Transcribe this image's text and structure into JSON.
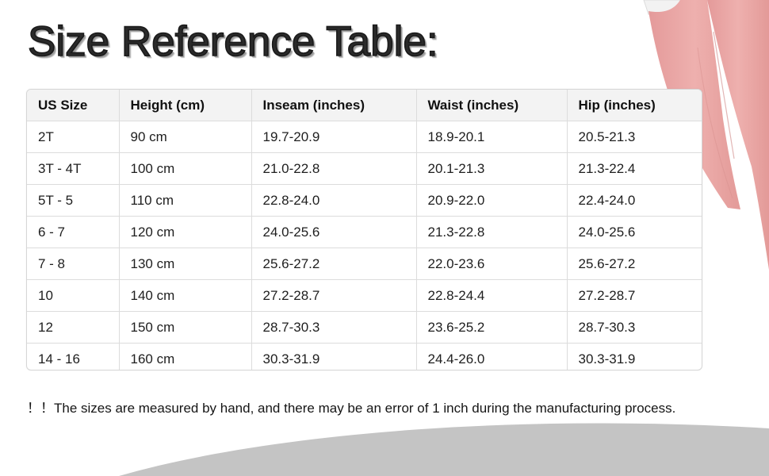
{
  "title": "Size Reference Table:",
  "table": {
    "headers": [
      "US Size",
      "Height (cm)",
      "Inseam (inches)",
      "Waist (inches)",
      "Hip (inches)"
    ],
    "rows": [
      [
        "2T",
        "90 cm",
        "19.7-20.9",
        "18.9-20.1",
        "20.5-21.3"
      ],
      [
        "3T - 4T",
        "100 cm",
        "21.0-22.8",
        "20.1-21.3",
        "21.3-22.4"
      ],
      [
        "5T - 5",
        "110 cm",
        "22.8-24.0",
        "20.9-22.0",
        "22.4-24.0"
      ],
      [
        "6 - 7",
        "120 cm",
        "24.0-25.6",
        "21.3-22.8",
        "24.0-25.6"
      ],
      [
        "7 - 8",
        "130 cm",
        "25.6-27.2",
        "22.0-23.6",
        "25.6-27.2"
      ],
      [
        "10",
        "140 cm",
        "27.2-28.7",
        "22.8-24.4",
        "27.2-28.7"
      ],
      [
        "12",
        "150 cm",
        "28.7-30.3",
        "23.6-25.2",
        "28.7-30.3"
      ],
      [
        "14 - 16",
        "160 cm",
        "30.3-31.9",
        "24.4-26.0",
        "30.3-31.9"
      ]
    ]
  },
  "note": "！！The sizes are measured by hand, and there may be an error of 1 inch during the manufacturing process.",
  "colors": {
    "garment": "#eba6a6",
    "arc": "#c4c4c4"
  },
  "icons": {
    "garment": "pink-leggings-image"
  }
}
